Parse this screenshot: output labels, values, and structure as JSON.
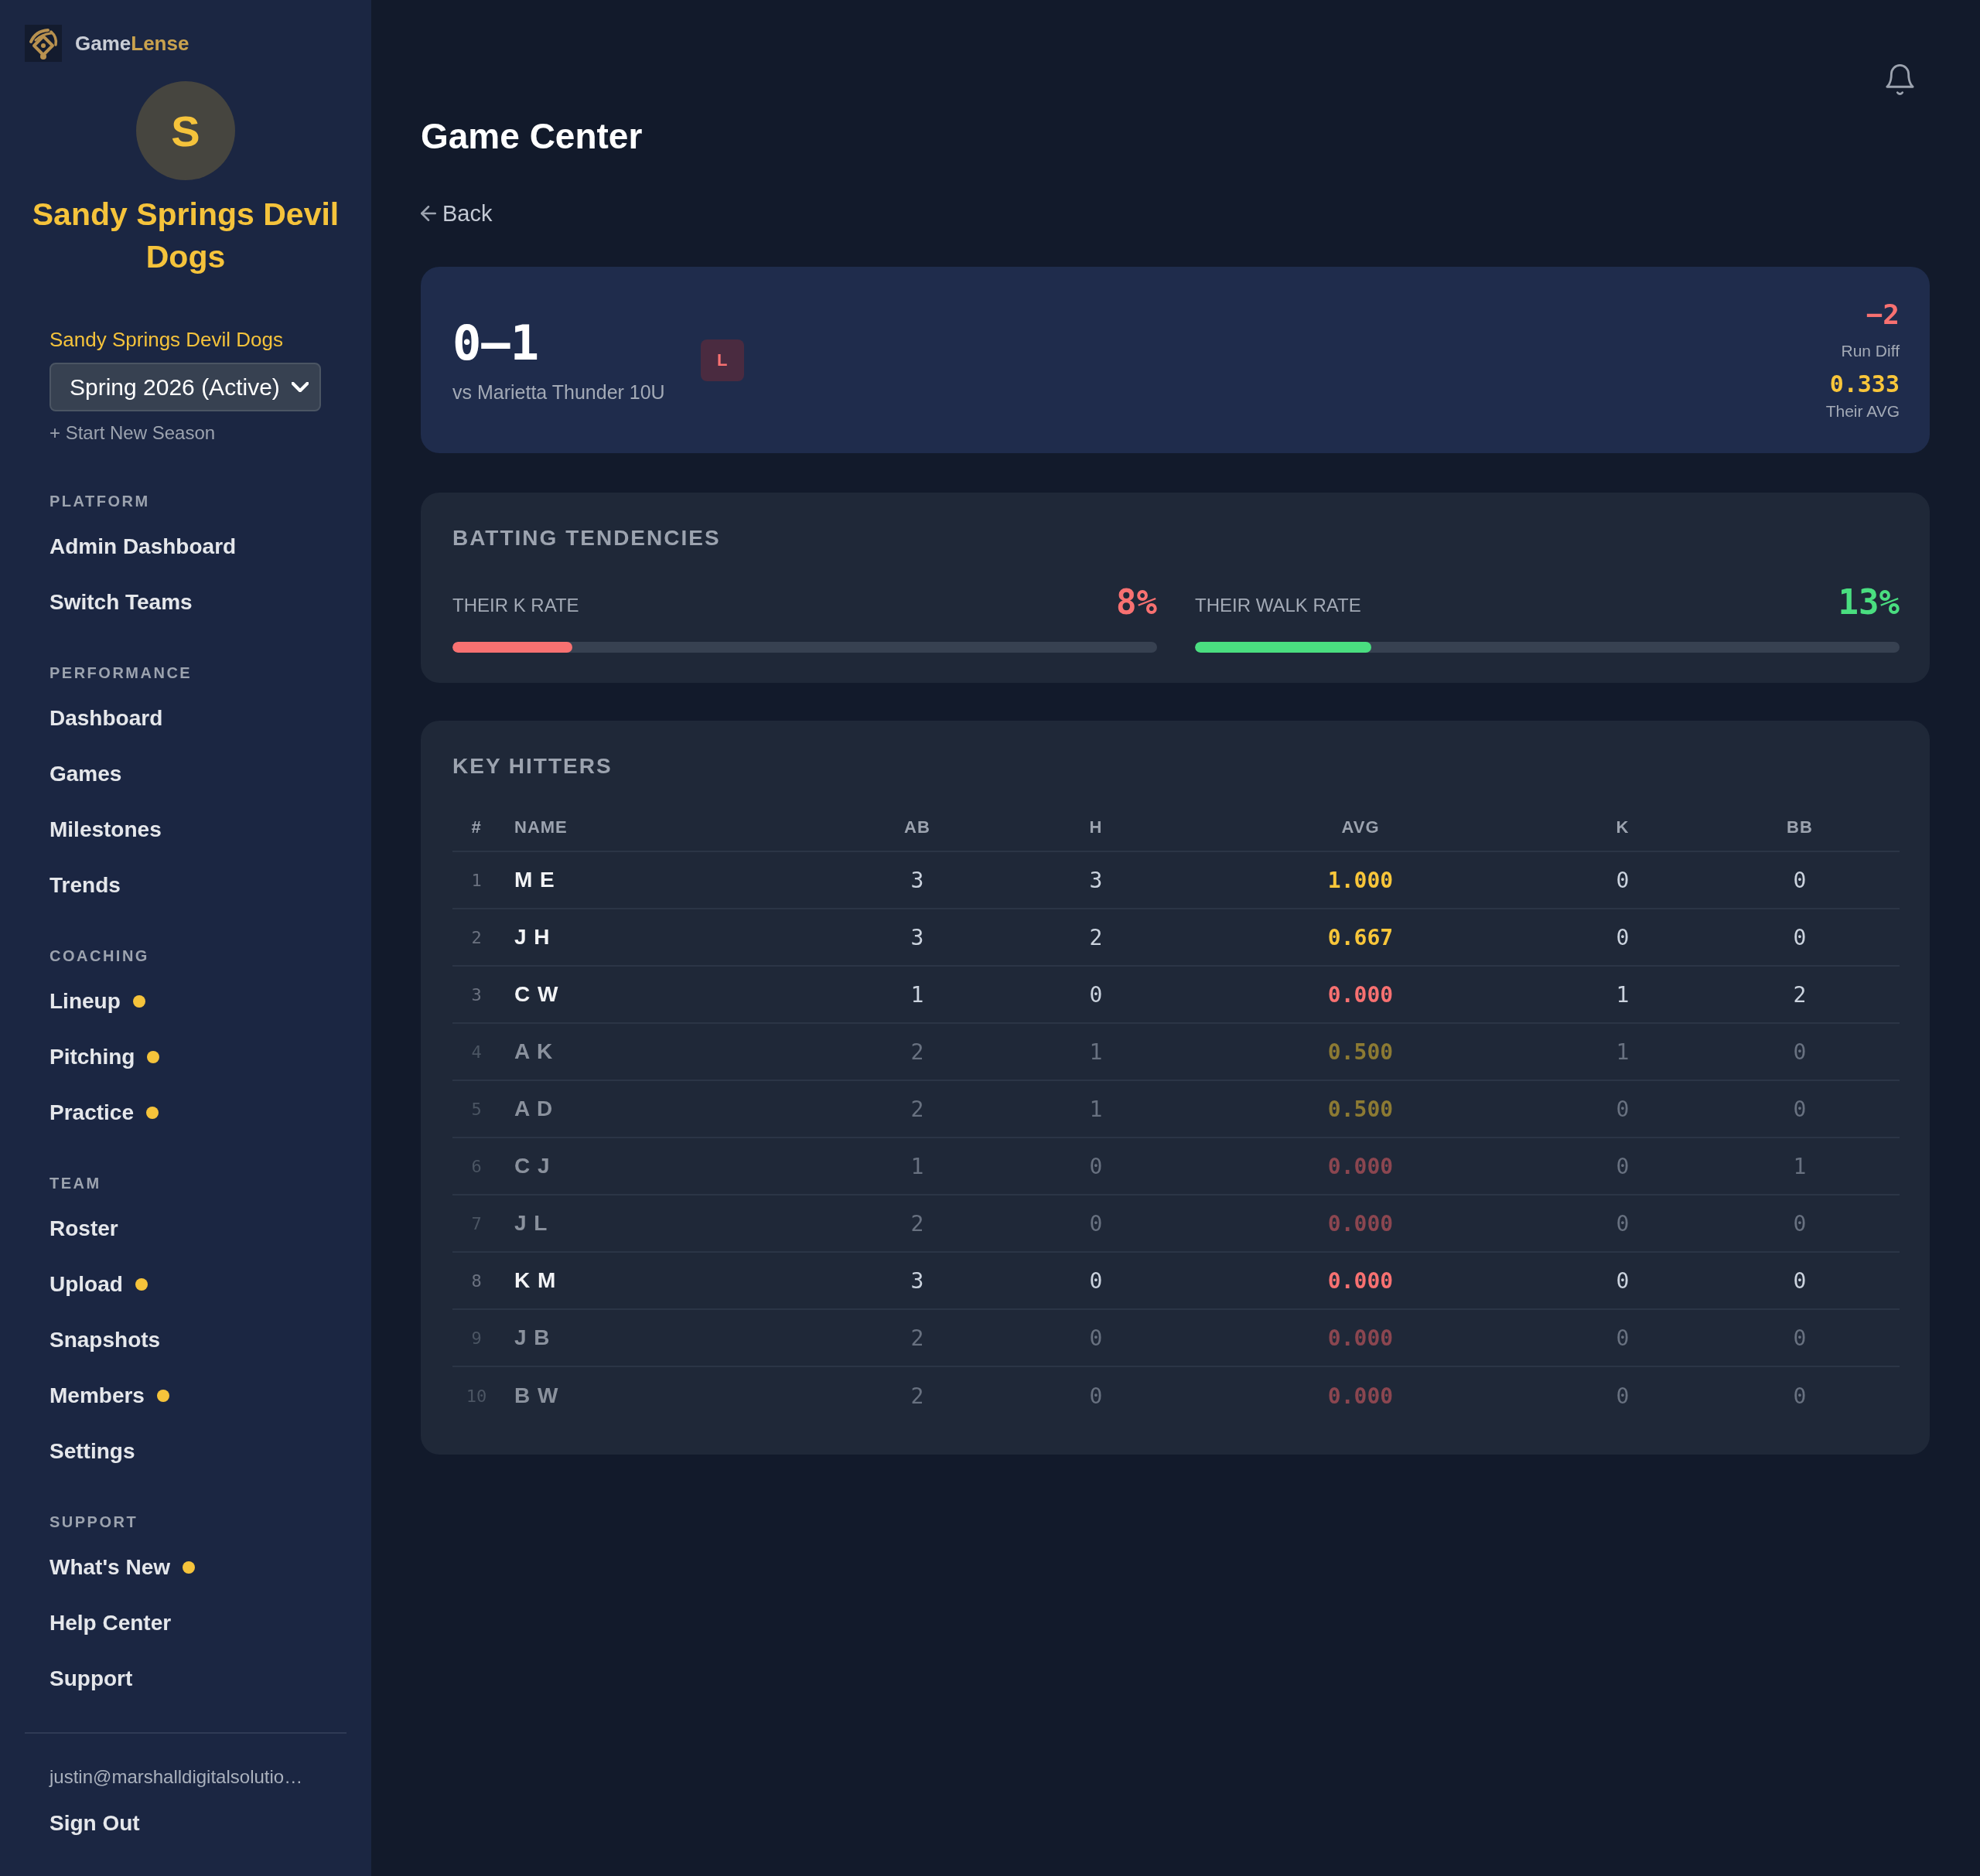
{
  "sidebar": {
    "brand": {
      "first": "Game",
      "second": "Lense"
    },
    "avatar": {
      "initial": "S"
    },
    "team_name": "Sandy Springs Devil Dogs",
    "team_label": "Sandy Springs Devil Dogs",
    "season_select": {
      "value": "Spring 2026 (Active)"
    },
    "new_season_link": "+ Start New Season",
    "sections": [
      {
        "label": "PLATFORM",
        "items": [
          {
            "label": "Admin Dashboard",
            "indicator": false
          },
          {
            "label": "Switch Teams",
            "indicator": false
          }
        ]
      },
      {
        "label": "PERFORMANCE",
        "items": [
          {
            "label": "Dashboard",
            "indicator": false
          },
          {
            "label": "Games",
            "indicator": false
          },
          {
            "label": "Milestones",
            "indicator": false
          },
          {
            "label": "Trends",
            "indicator": false
          }
        ]
      },
      {
        "label": "COACHING",
        "items": [
          {
            "label": "Lineup",
            "indicator": true
          },
          {
            "label": "Pitching",
            "indicator": true
          },
          {
            "label": "Practice",
            "indicator": true
          }
        ]
      },
      {
        "label": "TEAM",
        "items": [
          {
            "label": "Roster",
            "indicator": false
          },
          {
            "label": "Upload",
            "indicator": true
          },
          {
            "label": "Snapshots",
            "indicator": false
          },
          {
            "label": "Members",
            "indicator": true
          },
          {
            "label": "Settings",
            "indicator": false
          }
        ]
      },
      {
        "label": "SUPPORT",
        "items": [
          {
            "label": "What's New",
            "indicator": true
          },
          {
            "label": "Help Center",
            "indicator": false
          },
          {
            "label": "Support",
            "indicator": false
          }
        ]
      }
    ],
    "user_email": "justin@marshalldigitalsolutio…",
    "sign_out": "Sign Out"
  },
  "header": {
    "title": "Game Center",
    "back": "Back"
  },
  "game_summary": {
    "score": "0–1",
    "opponent": "vs Marietta Thunder 10U",
    "result": "L",
    "run_diff": {
      "value": "−2",
      "label": "Run Diff"
    },
    "their_avg": {
      "value": "0.333",
      "label": "Their AVG"
    }
  },
  "batting_tendencies": {
    "title": "BATTING TENDENCIES",
    "metrics": [
      {
        "label": "THEIR K RATE",
        "value": "8%",
        "level": 0.17,
        "color": "#f87171"
      },
      {
        "label": "THEIR WALK RATE",
        "value": "13%",
        "level": 0.25,
        "color": "#4ade80"
      }
    ]
  },
  "key_hitters": {
    "title": "KEY HITTERS",
    "columns": [
      "#",
      "NAME",
      "AB",
      "H",
      "AVG",
      "K",
      "BB"
    ],
    "rows": [
      {
        "number": "1",
        "name": "M E",
        "ab": "3",
        "h": "3",
        "avg": "1.000",
        "k": "0",
        "bb": "0",
        "dimmed": false,
        "color": "#f9c63a"
      },
      {
        "number": "2",
        "name": "J H",
        "ab": "3",
        "h": "2",
        "avg": "0.667",
        "k": "0",
        "bb": "0",
        "dimmed": false,
        "color": "#f9c63a"
      },
      {
        "number": "3",
        "name": "C W",
        "ab": "1",
        "h": "0",
        "avg": "0.000",
        "k": "1",
        "bb": "2",
        "dimmed": false,
        "color": "#f87171"
      },
      {
        "number": "4",
        "name": "A K",
        "ab": "2",
        "h": "1",
        "avg": "0.500",
        "k": "1",
        "bb": "0",
        "dimmed": true,
        "color": "#8c7a33"
      },
      {
        "number": "5",
        "name": "A D",
        "ab": "2",
        "h": "1",
        "avg": "0.500",
        "k": "0",
        "bb": "0",
        "dimmed": true,
        "color": "#8c7a33"
      },
      {
        "number": "6",
        "name": "C J",
        "ab": "1",
        "h": "0",
        "avg": "0.000",
        "k": "0",
        "bb": "1",
        "dimmed": true,
        "color": "#8b4650"
      },
      {
        "number": "7",
        "name": "J L",
        "ab": "2",
        "h": "0",
        "avg": "0.000",
        "k": "0",
        "bb": "0",
        "dimmed": true,
        "color": "#8b4650"
      },
      {
        "number": "8",
        "name": "K M",
        "ab": "3",
        "h": "0",
        "avg": "0.000",
        "k": "0",
        "bb": "0",
        "dimmed": false,
        "color": "#f87171"
      },
      {
        "number": "9",
        "name": "J B",
        "ab": "2",
        "h": "0",
        "avg": "0.000",
        "k": "0",
        "bb": "0",
        "dimmed": true,
        "color": "#8b4650"
      },
      {
        "number": "10",
        "name": "B W",
        "ab": "2",
        "h": "0",
        "avg": "0.000",
        "k": "0",
        "bb": "0",
        "dimmed": true,
        "color": "#8b4650"
      }
    ]
  }
}
